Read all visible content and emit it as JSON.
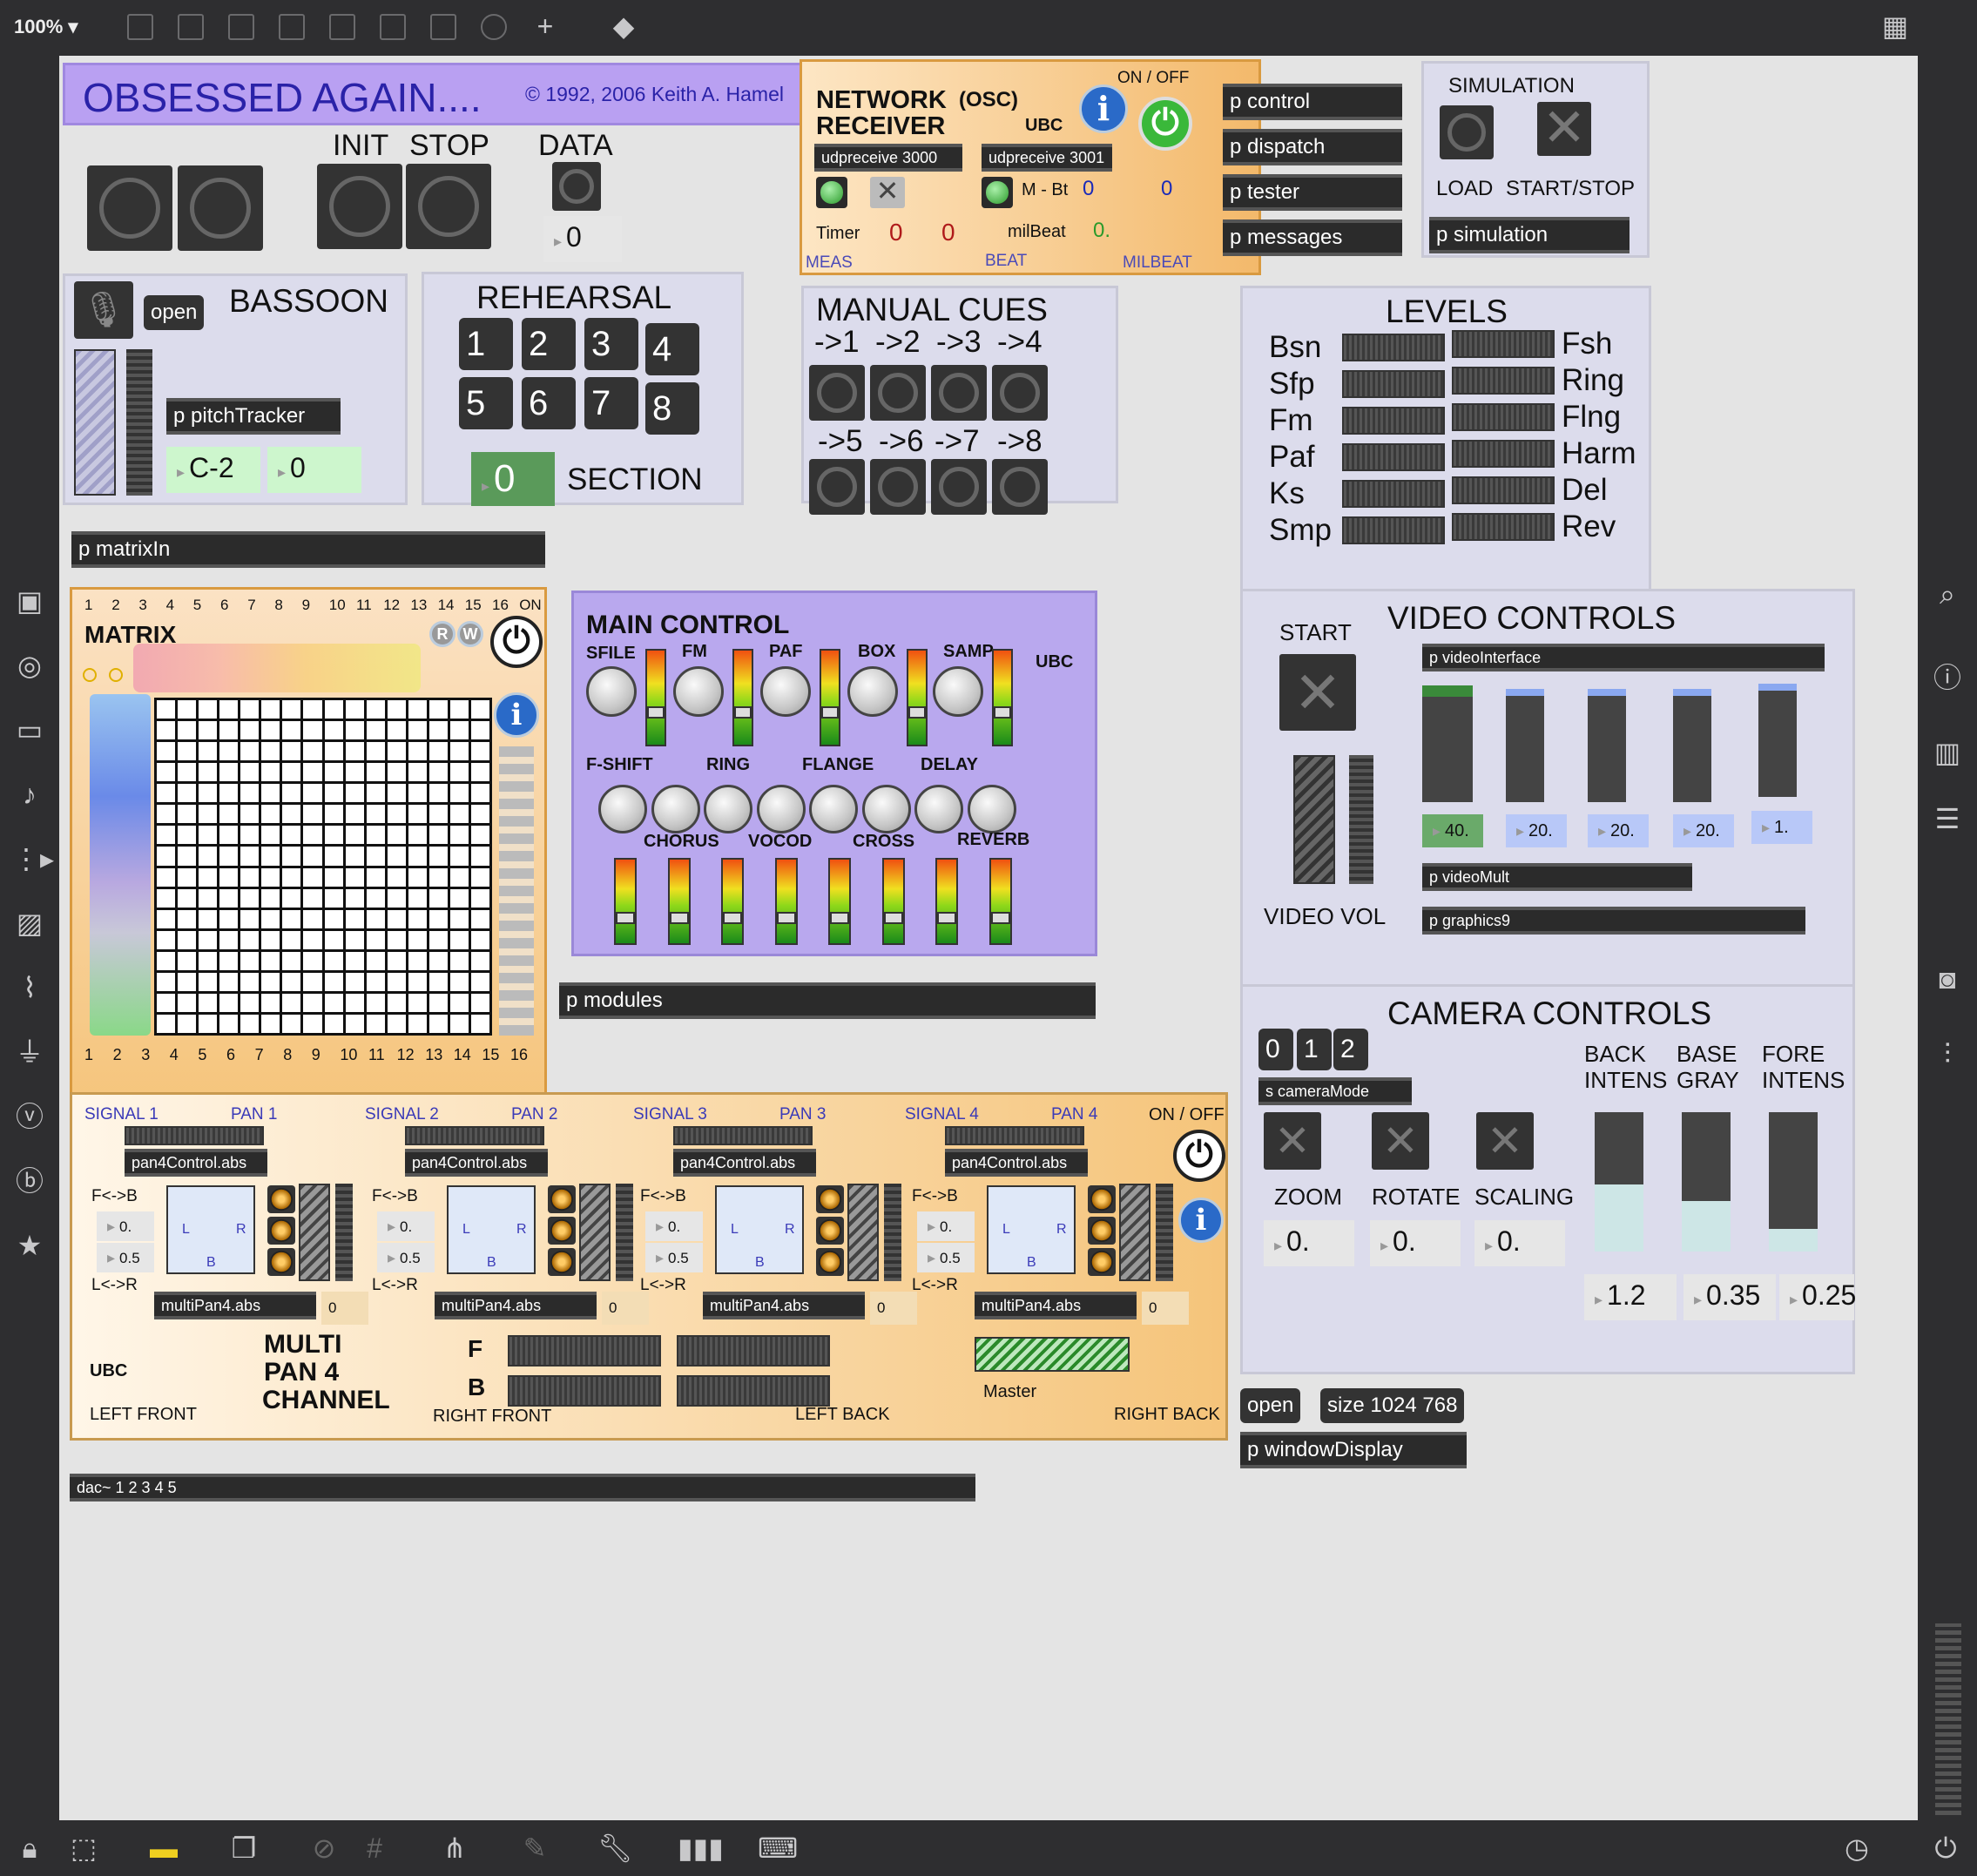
{
  "toolbar": {
    "zoom": "100%"
  },
  "title": {
    "main": "OBSESSED AGAIN....",
    "copyright": "© 1992, 2006 Keith A. Hamel"
  },
  "init_stop": {
    "init": "INIT",
    "stop": "STOP",
    "data": "DATA",
    "data_value": "0"
  },
  "network": {
    "title1": "NETWORK",
    "osc": "(OSC)",
    "title2": "RECEIVER",
    "ubc": "UBC",
    "on_off": "ON / OFF",
    "udp1": "udpreceive 3000",
    "udp2": "udpreceive 3001",
    "mbt": "M - Bt",
    "mbt_val1": "0",
    "mbt_val2": "0",
    "timer": "Timer",
    "timer_val1": "0",
    "timer_val2": "0",
    "milbeat": "milBeat",
    "milbeat_val": "0.",
    "meas": "MEAS",
    "beat": "BEAT",
    "milbeat_lbl": "MILBEAT"
  },
  "subpatches": [
    "p control",
    "p dispatch",
    "p tester",
    "p messages"
  ],
  "simulation": {
    "title": "SIMULATION",
    "load": "LOAD",
    "startstop": "START/STOP",
    "patch": "p simulation"
  },
  "bassoon": {
    "title": "BASSOON",
    "open": "open",
    "patch": "p pitchTracker",
    "note": "C-2",
    "value": "0"
  },
  "rehearsal": {
    "title": "REHEARSAL",
    "buttons": [
      "1",
      "2",
      "3",
      "4",
      "5",
      "6",
      "7",
      "8"
    ],
    "section_value": "0",
    "section": "SECTION"
  },
  "cues": {
    "title": "MANUAL CUES",
    "row1": [
      "->1",
      "->2",
      "->3",
      "->4"
    ],
    "row2": [
      "->5",
      "->6",
      "->7",
      "->8"
    ]
  },
  "levels": {
    "title": "LEVELS",
    "left": [
      "Bsn",
      "Sfp",
      "Fm",
      "Paf",
      "Ks",
      "Smp"
    ],
    "right": [
      "Fsh",
      "Ring",
      "Flng",
      "Harm",
      "Del",
      "Rev"
    ]
  },
  "matrixIn": "p matrixIn",
  "matrix": {
    "title": "MATRIX",
    "top_cols": [
      "1",
      "2",
      "3",
      "4",
      "5",
      "6",
      "7",
      "8",
      "9",
      "10",
      "11",
      "12",
      "13",
      "14",
      "15",
      "16",
      "ON"
    ],
    "bottom_cols": [
      "1",
      "2",
      "3",
      "4",
      "5",
      "6",
      "7",
      "8",
      "9",
      "10",
      "11",
      "12",
      "13",
      "14",
      "15",
      "16"
    ],
    "r": "R",
    "w": "W"
  },
  "main_control": {
    "title": "MAIN CONTROL",
    "ubc": "UBC",
    "row1": [
      "SFILE",
      "FM",
      "PAF",
      "BOX",
      "SAMP"
    ],
    "row2": [
      "F-SHIFT",
      "RING",
      "FLANGE",
      "DELAY"
    ],
    "row3": [
      "CHORUS",
      "VOCOD",
      "CROSS",
      "REVERB"
    ]
  },
  "modules": "p modules",
  "video": {
    "start": "START",
    "title": "VIDEO CONTROLS",
    "interface": "p videoInterface",
    "values": [
      "40.",
      "20.",
      "20.",
      "20.",
      "1."
    ],
    "vol": "VIDEO VOL",
    "mult": "p videoMult",
    "graphics": "p graphics9"
  },
  "camera": {
    "title": "CAMERA CONTROLS",
    "modes": [
      "0",
      "1",
      "2"
    ],
    "mode_patch": "s cameraMode",
    "back": "BACK",
    "intens": "INTENS",
    "base": "BASE",
    "gray": "GRAY",
    "fore": "FORE",
    "intens2": "INTENS",
    "zoom": "ZOOM",
    "rotate": "ROTATE",
    "scaling": "SCALING",
    "zoom_val": "0.",
    "rotate_val": "0.",
    "scaling_val": "0.",
    "back_val": "1.2",
    "base_val": "0.35",
    "fore_val": "0.25"
  },
  "window": {
    "open": "open",
    "size": "size 1024 768",
    "patch": "p windowDisplay"
  },
  "pan": {
    "signals": [
      "SIGNAL 1",
      "SIGNAL 2",
      "SIGNAL 3",
      "SIGNAL 4"
    ],
    "pans": [
      "PAN 1",
      "PAN 2",
      "PAN 3",
      "PAN 4"
    ],
    "control": "pan4Control.abs",
    "multi": "multiPan4.abs",
    "fb": "F<->B",
    "lr": "L<->R",
    "val_a": "0.",
    "val_b": "0.5",
    "out": "0",
    "on_off": "ON / OFF",
    "l": "L",
    "r": "R",
    "b": "B",
    "ubc": "UBC",
    "multi_title1": "MULTI",
    "multi_title2": "PAN 4",
    "multi_title3": "CHANNEL",
    "f": "F",
    "bk": "B",
    "master": "Master",
    "left_front": "LEFT FRONT",
    "right_front": "RIGHT FRONT",
    "left_back": "LEFT BACK",
    "right_back": "RIGHT BACK"
  },
  "dac": "dac~ 1 2 3 4 5",
  "colors": {
    "title_bg": "#b9a0f2",
    "title_fg": "#2a22a8",
    "orange": "#f5c47a",
    "purple": "#b9a8ee",
    "panel": "#dcdcec"
  }
}
